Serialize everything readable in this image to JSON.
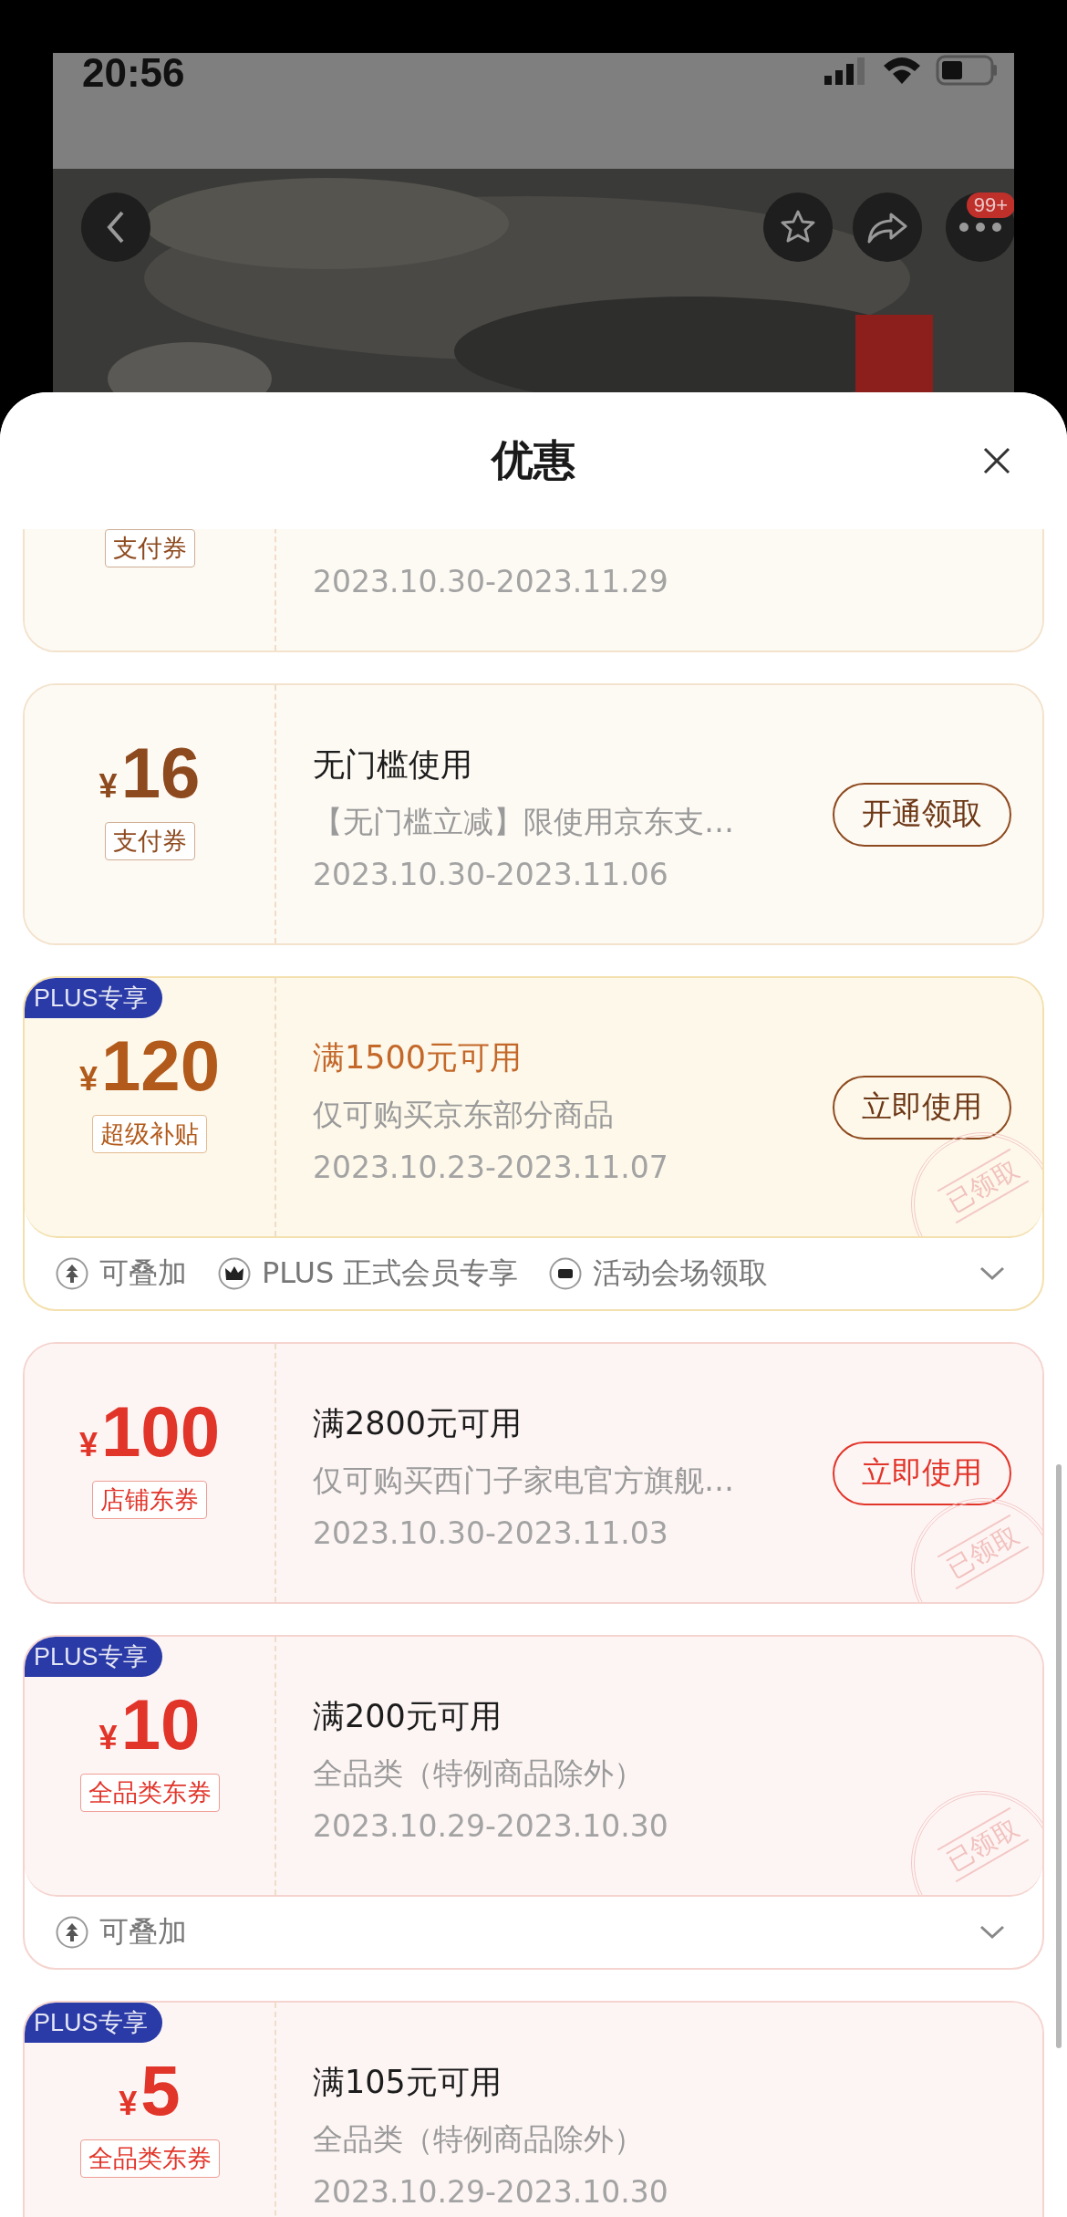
{
  "status_bar": {
    "time": "20:56"
  },
  "product_header": {
    "more_badge": "99+"
  },
  "sheet": {
    "title": "优惠"
  },
  "coupons": [
    {
      "kind": "brown",
      "tag": "支付券",
      "date": "2023.10.30-2023.11.29"
    },
    {
      "kind": "brown",
      "currency": "¥",
      "amount": "16",
      "tag": "支付券",
      "title": "无门槛使用",
      "desc": "【无门槛立减】限使用京东支…",
      "date": "2023.10.30-2023.11.06",
      "button": "开通领取"
    },
    {
      "kind": "gold",
      "badge": "PLUS专享",
      "currency": "¥",
      "amount": "120",
      "tag": "超级补贴",
      "title": "满1500元可用",
      "desc": "仅可购买京东部分商品",
      "date": "2023.10.23-2023.11.07",
      "button": "立即使用",
      "stamp": "已领取",
      "perks": [
        {
          "kind": "stack",
          "label": "可叠加"
        },
        {
          "kind": "crown",
          "label": "PLUS 正式会员专享"
        },
        {
          "kind": "ticket",
          "label": "活动会场领取"
        }
      ]
    },
    {
      "kind": "red",
      "currency": "¥",
      "amount": "100",
      "tag": "店铺东券",
      "title": "满2800元可用",
      "desc": "仅可购买西门子家电官方旗舰…",
      "date": "2023.10.30-2023.11.03",
      "button": "立即使用",
      "stamp": "已领取"
    },
    {
      "kind": "red",
      "badge": "PLUS专享",
      "currency": "¥",
      "amount": "10",
      "tag": "全品类东券",
      "title": "满200元可用",
      "desc": "全品类（特例商品除外）",
      "date": "2023.10.29-2023.10.30",
      "stamp": "已领取",
      "perks": [
        {
          "kind": "stack",
          "label": "可叠加"
        }
      ]
    },
    {
      "kind": "red",
      "badge": "PLUS专享",
      "currency": "¥",
      "amount": "5",
      "tag": "全品类东券",
      "title": "满105元可用",
      "desc": "全品类（特例商品除外）",
      "date": "2023.10.29-2023.10.30"
    }
  ]
}
